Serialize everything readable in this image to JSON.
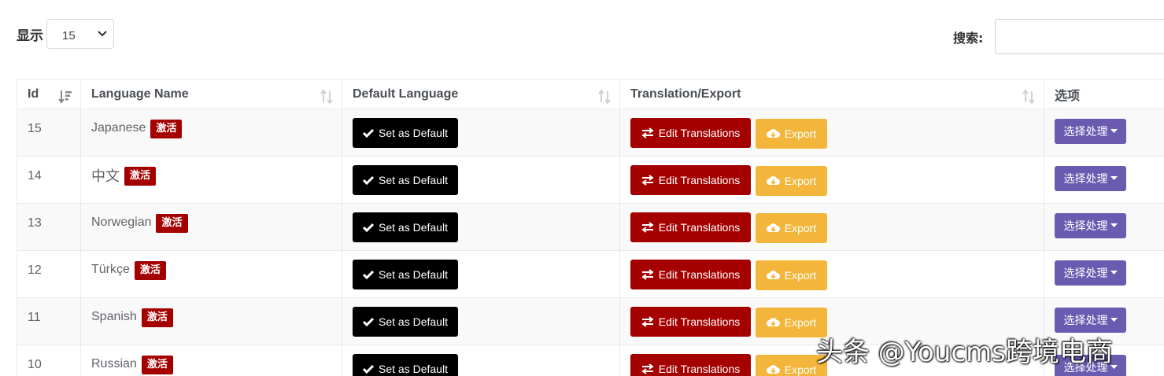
{
  "controls": {
    "show_label": "显示",
    "page_size": "15",
    "search_label": "搜索:",
    "search_value": ""
  },
  "table": {
    "headers": [
      "Id",
      "Language Name",
      "Default Language",
      "Translation/Export",
      "选项"
    ],
    "rows": [
      {
        "id": "15",
        "name": "Japanese",
        "badge": "激活"
      },
      {
        "id": "14",
        "name": "中文",
        "badge": "激活"
      },
      {
        "id": "13",
        "name": "Norwegian",
        "badge": "激活"
      },
      {
        "id": "12",
        "name": "Türkçe",
        "badge": "激活"
      },
      {
        "id": "11",
        "name": "Spanish",
        "badge": "激活"
      },
      {
        "id": "10",
        "name": "Russian",
        "badge": "激活"
      }
    ],
    "set_default_label": "Set as Default",
    "edit_label": "Edit Translations",
    "export_label": "Export",
    "options_label": "选择处理"
  },
  "watermark": "头条 @Youcms跨境电商",
  "colors": {
    "badge": "#a50000",
    "default_button": "#000000",
    "edit_button": "#a50000",
    "export_button": "#f3b63a",
    "options_button": "#6a5bb0"
  }
}
